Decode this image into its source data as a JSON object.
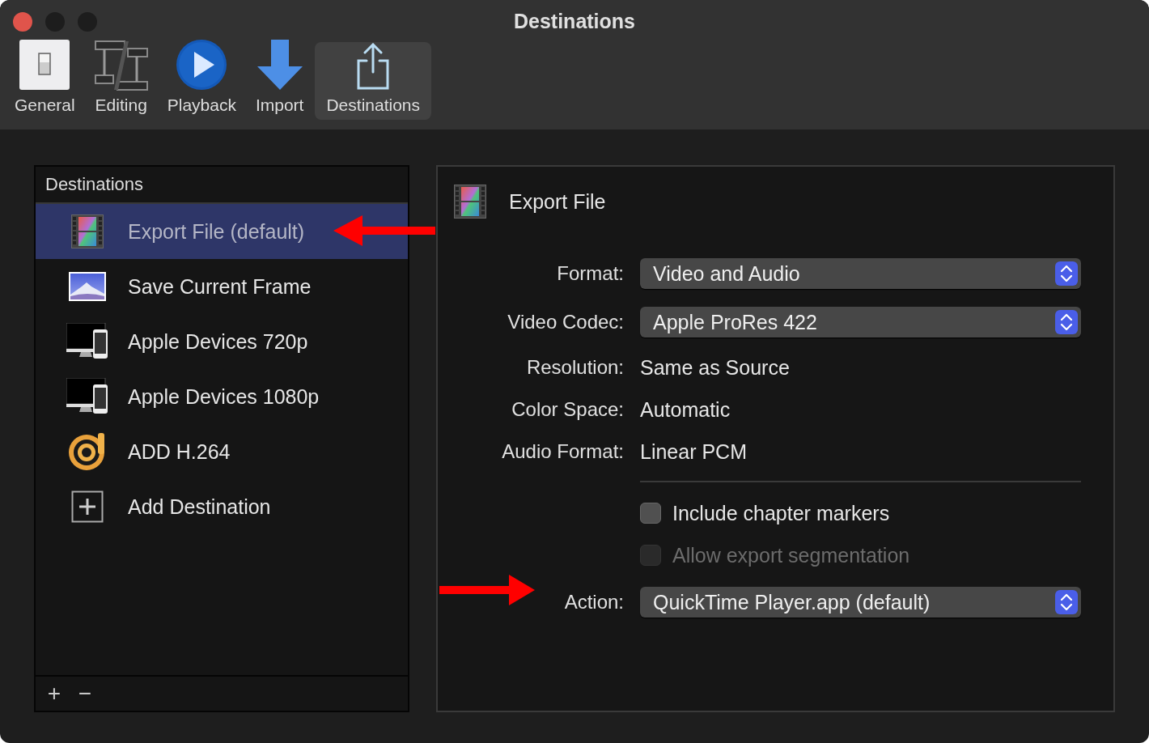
{
  "window": {
    "title": "Destinations"
  },
  "toolbar": [
    {
      "label": "General",
      "kind": "general",
      "selected": false
    },
    {
      "label": "Editing",
      "kind": "editing",
      "selected": false
    },
    {
      "label": "Playback",
      "kind": "playback",
      "selected": false
    },
    {
      "label": "Import",
      "kind": "import",
      "selected": false
    },
    {
      "label": "Destinations",
      "kind": "share",
      "selected": true
    }
  ],
  "sidebar": {
    "header": "Destinations",
    "items": [
      {
        "label": "Export File (default)",
        "kind": "film",
        "selected": true
      },
      {
        "label": "Save Current Frame",
        "kind": "picture",
        "selected": false
      },
      {
        "label": "Apple Devices 720p",
        "kind": "devices",
        "selected": false
      },
      {
        "label": "Apple Devices 1080p",
        "kind": "devices",
        "selected": false
      },
      {
        "label": "ADD H.264",
        "kind": "addlogo",
        "selected": false
      },
      {
        "label": "Add Destination",
        "kind": "plus",
        "selected": false
      }
    ],
    "footer_buttons": [
      "+",
      "−"
    ]
  },
  "detail": {
    "title": "Export File",
    "settings": [
      {
        "label": "Format:",
        "kind": "popup",
        "value": "Video and Audio"
      },
      {
        "label": "Video Codec:",
        "kind": "popup",
        "value": "Apple ProRes 422"
      },
      {
        "label": "Resolution:",
        "kind": "text",
        "value": "Same as Source"
      },
      {
        "label": "Color Space:",
        "kind": "text",
        "value": "Automatic"
      },
      {
        "label": "Audio Format:",
        "kind": "text",
        "value": "Linear PCM"
      }
    ],
    "options": [
      {
        "label": "Include chapter markers",
        "checked": false,
        "disabled": false
      },
      {
        "label": "Allow export segmentation",
        "checked": false,
        "disabled": true
      }
    ],
    "action": {
      "label": "Action:",
      "kind": "popup",
      "value": "QuickTime Player.app (default)"
    }
  }
}
